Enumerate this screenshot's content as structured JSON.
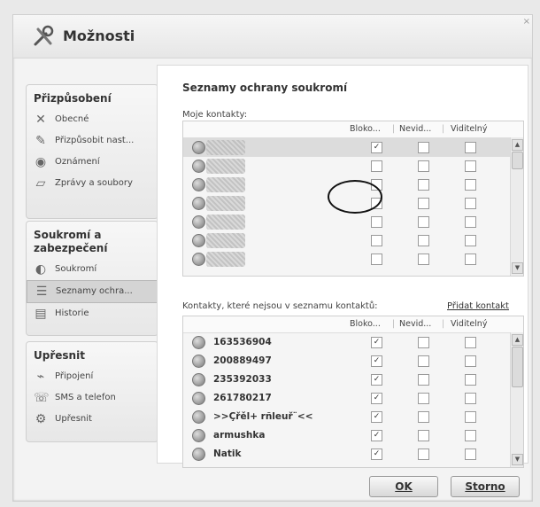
{
  "window": {
    "title": "Možnosti"
  },
  "sidebar": {
    "groups": [
      {
        "title": "Přizpůsobení",
        "items": [
          {
            "label": "Obecné",
            "icon": "tools-icon"
          },
          {
            "label": "Přizpůsobit nast...",
            "icon": "paint-icon"
          },
          {
            "label": "Oznámení",
            "icon": "notification-icon"
          },
          {
            "label": "Zprávy a soubory",
            "icon": "folder-icon"
          }
        ]
      },
      {
        "title": "Soukromí a zabezpečení",
        "items": [
          {
            "label": "Soukromí",
            "icon": "privacy-icon"
          },
          {
            "label": "Seznamy ochra...",
            "icon": "lists-icon",
            "selected": true
          },
          {
            "label": "Historie",
            "icon": "history-icon"
          }
        ]
      },
      {
        "title": "Upřesnit",
        "items": [
          {
            "label": "Připojení",
            "icon": "connection-icon"
          },
          {
            "label": "SMS a telefon",
            "icon": "phone-icon"
          },
          {
            "label": "Upřesnit",
            "icon": "advanced-icon"
          }
        ]
      }
    ]
  },
  "main": {
    "heading": "Seznamy ochrany soukromí",
    "my_contacts_label": "Moje kontakty:",
    "other_contacts_label": "Kontakty, které nejsou v seznamu kontaktů:",
    "add_contact_link": "Přidat kontakt",
    "columns": [
      "Bloko...",
      "Nevid...",
      "Viditelný"
    ],
    "my_contacts": [
      {
        "blocked": true,
        "invisible": false,
        "visible": false
      },
      {
        "blocked": false,
        "invisible": false,
        "visible": false
      },
      {
        "blocked": false,
        "invisible": false,
        "visible": false
      },
      {
        "blocked": false,
        "invisible": false,
        "visible": false
      },
      {
        "blocked": false,
        "invisible": false,
        "visible": false
      },
      {
        "blocked": false,
        "invisible": false,
        "visible": false
      },
      {
        "blocked": false,
        "invisible": false,
        "visible": false
      }
    ],
    "other_contacts": [
      {
        "name": "163536904",
        "blocked": true
      },
      {
        "name": "200889497",
        "blocked": true
      },
      {
        "name": "235392033",
        "blocked": true
      },
      {
        "name": "261780217",
        "blocked": true
      },
      {
        "name": ">>Çřěl+ rñleuř¨<<",
        "blocked": true
      },
      {
        "name": "armushka",
        "blocked": true
      },
      {
        "name": "Natik",
        "blocked": true
      }
    ]
  },
  "buttons": {
    "ok": "OK",
    "cancel": "Storno"
  },
  "check_mark": "✓"
}
